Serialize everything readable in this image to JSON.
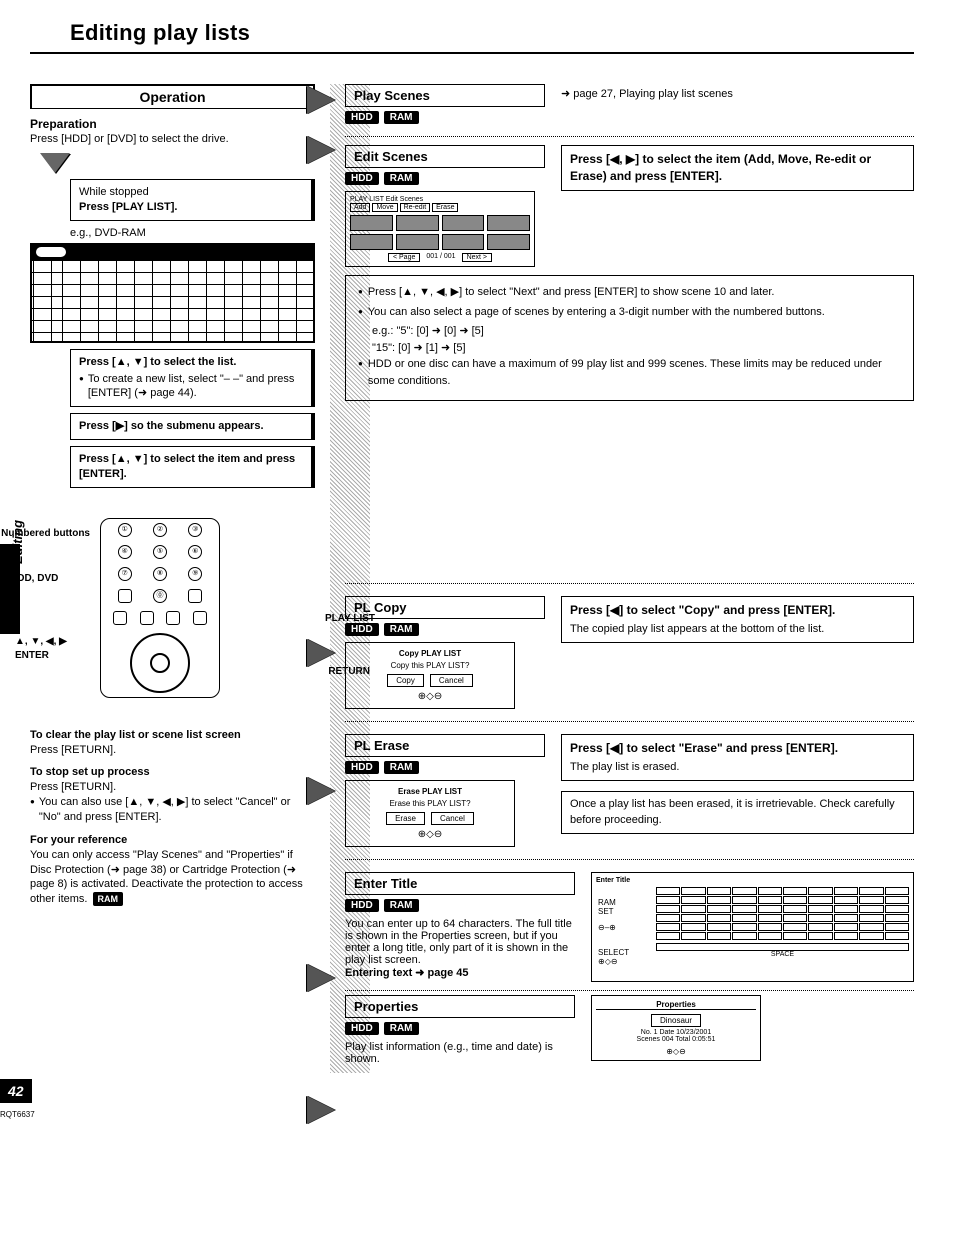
{
  "page_title": "Editing play lists",
  "page_number": "42",
  "doc_id": "RQT6637",
  "side_label": "Editing",
  "left": {
    "operation": "Operation",
    "prep_label": "Preparation",
    "prep_text": "Press [HDD] or [DVD] to select the drive.",
    "step1a": "While stopped",
    "step1b": "Press [PLAY LIST].",
    "eg": "e.g., DVD-RAM",
    "step2a": "Press [▲, ▼] to select the list.",
    "step2b": "To create a new list, select \"– –\" and press [ENTER] (➜ page 44).",
    "step3": "Press [▶] so the submenu appears.",
    "step4": "Press [▲, ▼] to select the item and press [ENTER].",
    "remote": {
      "numbered": "Numbered buttons",
      "hdd": "HDD, DVD",
      "playlist": "PLAY LIST",
      "arrows": "▲, ▼, ◀, ▶",
      "enter": "ENTER",
      "return": "RETURN"
    },
    "notes": {
      "h1": "To clear the play list or scene list screen",
      "t1": "Press [RETURN].",
      "h2": "To stop set up process",
      "t2": "Press [RETURN].",
      "b1": "You can also use [▲, ▼, ◀, ▶] to select \"Cancel\" or \"No\" and press [ENTER].",
      "h3": "For your reference",
      "t3a": "You can only access \"Play Scenes\" and \"Properties\" if Disc Protection (➜ page 38) or Cartridge Protection (➜ page 8) is activated. Deactivate the protection to access other items.",
      "t3b": "RAM"
    }
  },
  "right": {
    "play_scenes": {
      "title": "Play Scenes",
      "badges": [
        "HDD",
        "RAM"
      ],
      "ref": "page 27, Playing play list scenes"
    },
    "edit_scenes": {
      "title": "Edit Scenes",
      "badges": [
        "HDD",
        "RAM"
      ],
      "action": "Press [◀, ▶] to select the item (Add, Move, Re-edit or Erase) and press [ENTER].",
      "grid": {
        "hdr_label": "PLAY LIST Edit Scenes",
        "tabs": [
          "Add",
          "Move",
          "Re-edit",
          "Erase"
        ],
        "page_prev": "< Page",
        "page_ind": "001 / 001",
        "page_next": "Next >"
      },
      "notes": {
        "b1": "Press [▲, ▼, ◀, ▶] to select \"Next\" and press [ENTER] to show scene 10 and later.",
        "b2": "You can also select a page of scenes by entering a 3-digit number with the numbered buttons.",
        "eg1": "e.g.: \"5\":   [0] ➜ [0] ➜ [5]",
        "eg2": "        \"15\": [0] ➜ [1] ➜ [5]",
        "b3": "HDD or one disc can have a maximum of 99 play list and 999 scenes. These limits may be reduced under some conditions."
      }
    },
    "pl_copy": {
      "title": "PL Copy",
      "badges": [
        "HDD",
        "RAM"
      ],
      "screen": {
        "t": "Copy PLAY LIST",
        "q": "Copy this PLAY LIST?",
        "b1": "Copy",
        "b2": "Cancel"
      },
      "action": "Press [◀] to select \"Copy\" and press [ENTER].",
      "note": "The copied play list appears at the bottom of the list."
    },
    "pl_erase": {
      "title": "PL Erase",
      "badges": [
        "HDD",
        "RAM"
      ],
      "screen": {
        "t": "Erase PLAY LIST",
        "q": "Erase this PLAY LIST?",
        "b1": "Erase",
        "b2": "Cancel"
      },
      "action": "Press [◀] to select \"Erase\" and press [ENTER].",
      "note": "The play list is erased.",
      "warn": "Once a play list has been erased, it is irretrievable. Check carefully before proceeding."
    },
    "enter_title": {
      "title": "Enter Title",
      "badges": [
        "HDD",
        "RAM"
      ],
      "desc": "You can enter up to 64 characters. The full title is shown in the Properties screen, but if you enter a long title, only part of it is shown in the play list screen.",
      "ref": "Entering text ➜ page 45",
      "img_hdr": "Enter Title",
      "img_space": "SPACE"
    },
    "properties": {
      "title": "Properties",
      "badges": [
        "HDD",
        "RAM"
      ],
      "desc": "Play list information (e.g., time and date) is shown.",
      "box": {
        "pt": "Properties",
        "pn": "Dinosaur",
        "l1": "No.   1     Date 10/23/2001",
        "l2": "Scenes 004   Total 0:05:51"
      }
    }
  }
}
